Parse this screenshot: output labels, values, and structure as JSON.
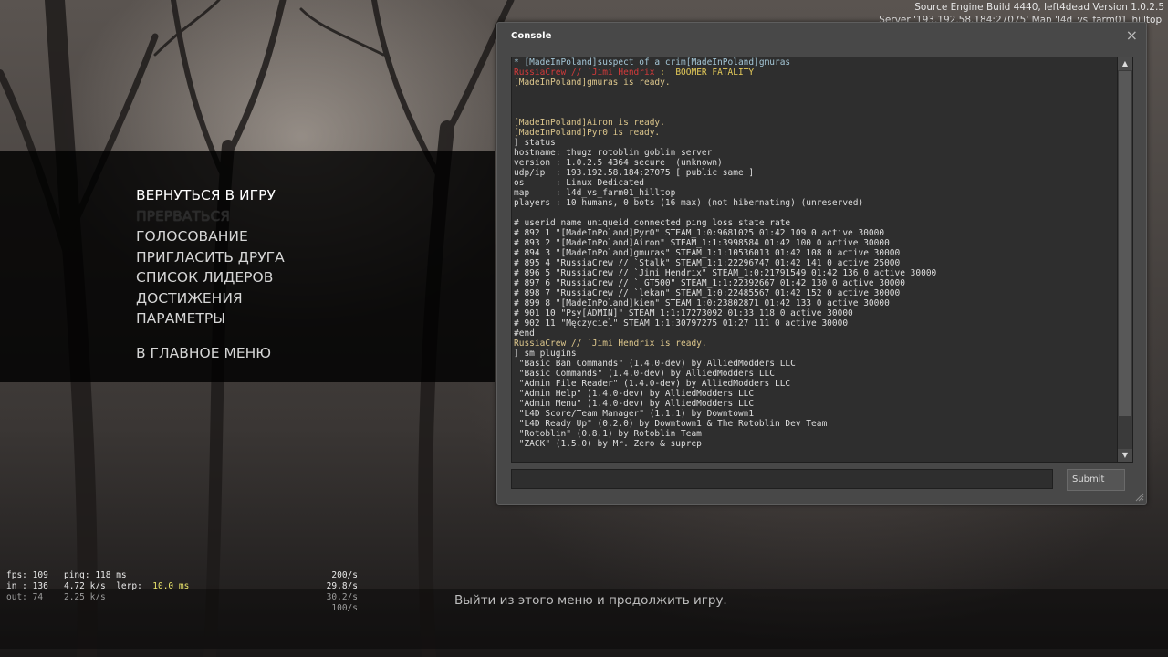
{
  "top_info": {
    "line1": "Source Engine Build 4440, left4dead Version 1.0.2.5",
    "line2": "Server '193.192.58.184:27075' Map 'l4d_vs_farm01_hilltop'"
  },
  "menu": {
    "items": [
      {
        "label": "ВЕРНУТЬСЯ В ИГРУ",
        "state": "active"
      },
      {
        "label": "ПРЕРВАТЬСЯ",
        "state": "disabled"
      },
      {
        "label": "ГОЛОСОВАНИЕ",
        "state": "normal"
      },
      {
        "label": "ПРИГЛАСИТЬ ДРУГА",
        "state": "normal"
      },
      {
        "label": "СПИСОК ЛИДЕРОВ",
        "state": "normal"
      },
      {
        "label": "ДОСТИЖЕНИЯ",
        "state": "normal"
      },
      {
        "label": "ПАРАМЕТРЫ",
        "state": "normal"
      },
      {
        "label": "В ГЛАВНОЕ МЕНЮ",
        "state": "normal"
      }
    ]
  },
  "hint": "Выйти из этого меню и продолжить игру.",
  "netgraph": {
    "fps_label": "fps:",
    "fps": "109",
    "ping_label": "ping:",
    "ping": "118 ms",
    "in_label": "in :",
    "in_bytes": "136",
    "in_rate": "4.72 k/s",
    "lerp_label": "lerp:",
    "lerp": "10.0 ms",
    "out_label": "out:",
    "out_bytes": "74",
    "out_rate": "2.25 k/s",
    "rates": [
      "200/s",
      "29.8/s",
      "30.2/s",
      "100/s"
    ]
  },
  "console": {
    "title": "Console",
    "close_icon": "×",
    "submit_label": "Submit",
    "input_value": "",
    "lines": [
      {
        "kind": "info",
        "text": "* [MadeInPoland]suspect of a crim[MadeInPoland]gmuras"
      },
      {
        "kind": "kill",
        "attacker": "RussiaCrew // `Jimi Hendrix",
        "sep": " :  ",
        "event": "BOOMER FATALITY"
      },
      {
        "kind": "ready",
        "text": "[MadeInPoland]gmuras is ready."
      },
      {
        "kind": "plain",
        "text": ""
      },
      {
        "kind": "plain",
        "text": ""
      },
      {
        "kind": "plain",
        "text": ""
      },
      {
        "kind": "ready",
        "text": "[MadeInPoland]Airon is ready."
      },
      {
        "kind": "ready",
        "text": "[MadeInPoland]Pyr0 is ready."
      },
      {
        "kind": "plain",
        "text": "] status"
      },
      {
        "kind": "plain",
        "text": "hostname: thugz rotoblin goblin server"
      },
      {
        "kind": "plain",
        "text": "version : 1.0.2.5 4364 secure  (unknown)"
      },
      {
        "kind": "plain",
        "text": "udp/ip  : 193.192.58.184:27075 [ public same ]"
      },
      {
        "kind": "plain",
        "text": "os      : Linux Dedicated"
      },
      {
        "kind": "plain",
        "text": "map     : l4d_vs_farm01_hilltop"
      },
      {
        "kind": "plain",
        "text": "players : 10 humans, 0 bots (16 max) (not hibernating) (unreserved)"
      },
      {
        "kind": "plain",
        "text": ""
      },
      {
        "kind": "plain",
        "text": "# userid name uniqueid connected ping loss state rate"
      },
      {
        "kind": "plain",
        "text": "# 892 1 \"[MadeInPoland]Pyr0\" STEAM_1:0:9681025 01:42 109 0 active 30000"
      },
      {
        "kind": "plain",
        "text": "# 893 2 \"[MadeInPoland]Airon\" STEAM_1:1:3998584 01:42 100 0 active 30000"
      },
      {
        "kind": "plain",
        "text": "# 894 3 \"[MadeInPoland]gmuras\" STEAM_1:1:10536013 01:42 108 0 active 30000"
      },
      {
        "kind": "plain",
        "text": "# 895 4 \"RussiaCrew // `Stalk\" STEAM_1:1:22296747 01:42 141 0 active 25000"
      },
      {
        "kind": "plain",
        "text": "# 896 5 \"RussiaCrew // `Jimi Hendrix\" STEAM_1:0:21791549 01:42 136 0 active 30000"
      },
      {
        "kind": "plain",
        "text": "# 897 6 \"RussiaCrew // ` GT500\" STEAM_1:1:22392667 01:42 130 0 active 30000"
      },
      {
        "kind": "plain",
        "text": "# 898 7 \"RussiaCrew // `lekan\" STEAM_1:0:22485567 01:42 152 0 active 30000"
      },
      {
        "kind": "plain",
        "text": "# 899 8 \"[MadeInPoland]kien\" STEAM_1:0:23802871 01:42 133 0 active 30000"
      },
      {
        "kind": "plain",
        "text": "# 901 10 \"Psy[ADMIN]\" STEAM_1:1:17273092 01:33 118 0 active 30000"
      },
      {
        "kind": "plain",
        "text": "# 902 11 \"Męczyciel\" STEAM_1:1:30797275 01:27 111 0 active 30000"
      },
      {
        "kind": "plain",
        "text": "#end"
      },
      {
        "kind": "ready",
        "text": "RussiaCrew // `Jimi Hendrix is ready."
      },
      {
        "kind": "plain",
        "text": "] sm plugins"
      },
      {
        "kind": "plain",
        "text": " \"Basic Ban Commands\" (1.4.0-dev) by AlliedModders LLC"
      },
      {
        "kind": "plain",
        "text": " \"Basic Commands\" (1.4.0-dev) by AlliedModders LLC"
      },
      {
        "kind": "plain",
        "text": " \"Admin File Reader\" (1.4.0-dev) by AlliedModders LLC"
      },
      {
        "kind": "plain",
        "text": " \"Admin Help\" (1.4.0-dev) by AlliedModders LLC"
      },
      {
        "kind": "plain",
        "text": " \"Admin Menu\" (1.4.0-dev) by AlliedModders LLC"
      },
      {
        "kind": "plain",
        "text": " \"L4D Score/Team Manager\" (1.1.1) by Downtown1"
      },
      {
        "kind": "plain",
        "text": " \"L4D Ready Up\" (0.2.0) by Downtown1 & The Rotoblin Dev Team"
      },
      {
        "kind": "plain",
        "text": " \"Rotoblin\" (0.8.1) by Rotoblin Team"
      },
      {
        "kind": "plain",
        "text": " \"ZACK\" (1.5.0) by Mr. Zero & suprep"
      }
    ]
  }
}
